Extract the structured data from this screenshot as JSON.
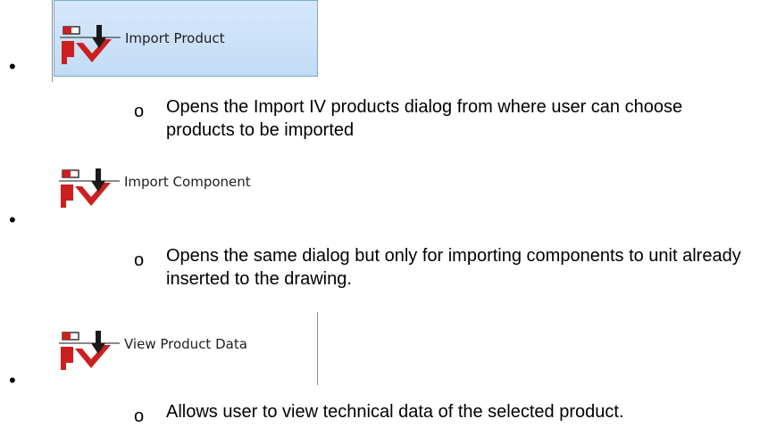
{
  "items": [
    {
      "button_label": "Import Product",
      "icon": "iv-import-icon",
      "selected": true,
      "description": "Opens the Import IV products dialog from where user can choose products to be imported"
    },
    {
      "button_label": "Import Component",
      "icon": "iv-import-icon",
      "selected": false,
      "description": "Opens the same dialog but only for importing components to unit already inserted to the drawing."
    },
    {
      "button_label": "View Product Data",
      "icon": "iv-import-icon",
      "selected": false,
      "description": "Allows user to view technical data of the selected product."
    }
  ],
  "colors": {
    "icon_red": "#cc1f1f",
    "selected_bg": "#c9e0f7",
    "selected_border": "#7aa7d6"
  }
}
